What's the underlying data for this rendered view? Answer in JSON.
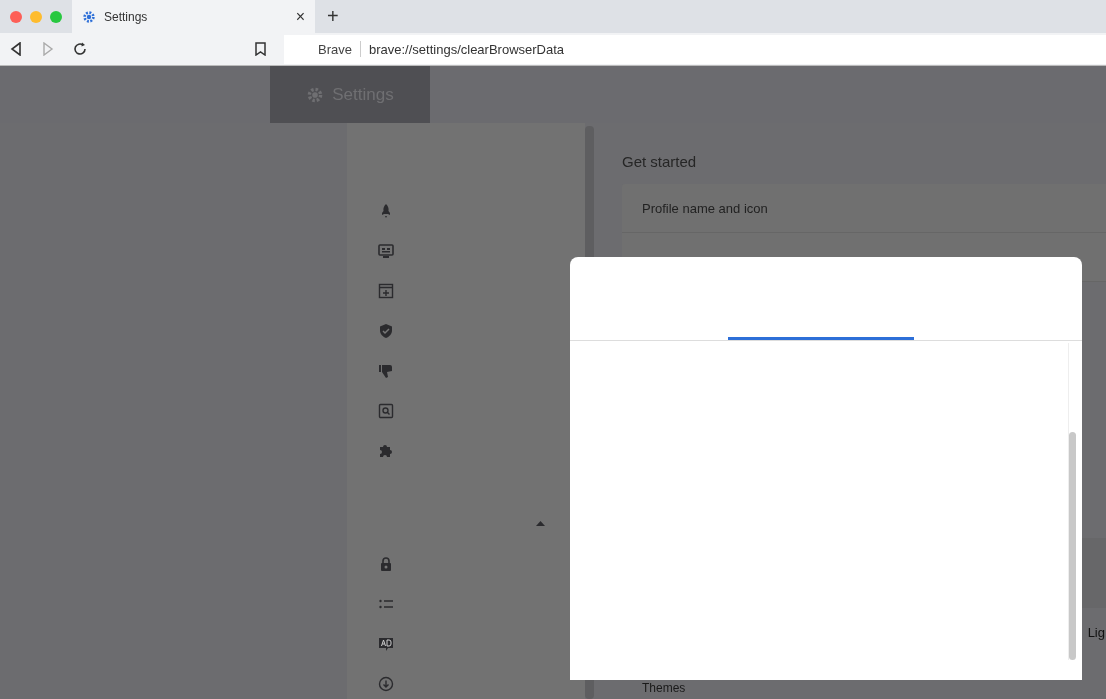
{
  "browser_tab": {
    "title": "Settings",
    "close": "×"
  },
  "new_tab": "+",
  "address_bar": {
    "site_label": "Brave",
    "url": "brave://settings/clearBrowserData"
  },
  "header": {
    "title": "Settings"
  },
  "content": {
    "section_title": "Get started",
    "rows": [
      "Profile name and icon"
    ],
    "right_cut_text": "Lig",
    "themes_label": "Themes"
  }
}
